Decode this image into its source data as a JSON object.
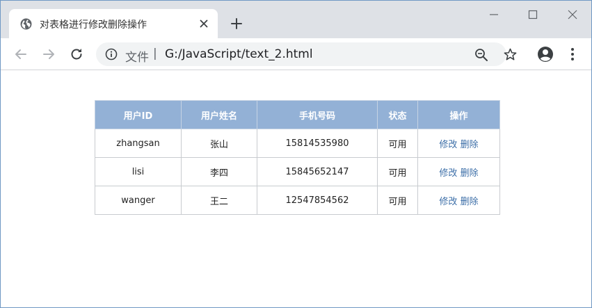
{
  "browser": {
    "tab_title": "对表格进行修改删除操作",
    "address": {
      "scheme_label": "文件",
      "separator": "|",
      "url": "G:/JavaScript/text_2.html"
    }
  },
  "table": {
    "headers": [
      "用户ID",
      "用户姓名",
      "手机号码",
      "状态",
      "操作"
    ],
    "rows": [
      {
        "id": "zhangsan",
        "name": "张山",
        "phone": "15814535980",
        "status": "可用",
        "edit": "修改",
        "delete": "删除"
      },
      {
        "id": "lisi",
        "name": "李四",
        "phone": "15845652147",
        "status": "可用",
        "edit": "修改",
        "delete": "删除"
      },
      {
        "id": "wanger",
        "name": "王二",
        "phone": "12547854562",
        "status": "可用",
        "edit": "修改",
        "delete": "删除"
      }
    ]
  },
  "colors": {
    "header_bg": "#93b1d6",
    "link": "#3d6fa8",
    "window_border": "#6f98c4"
  }
}
